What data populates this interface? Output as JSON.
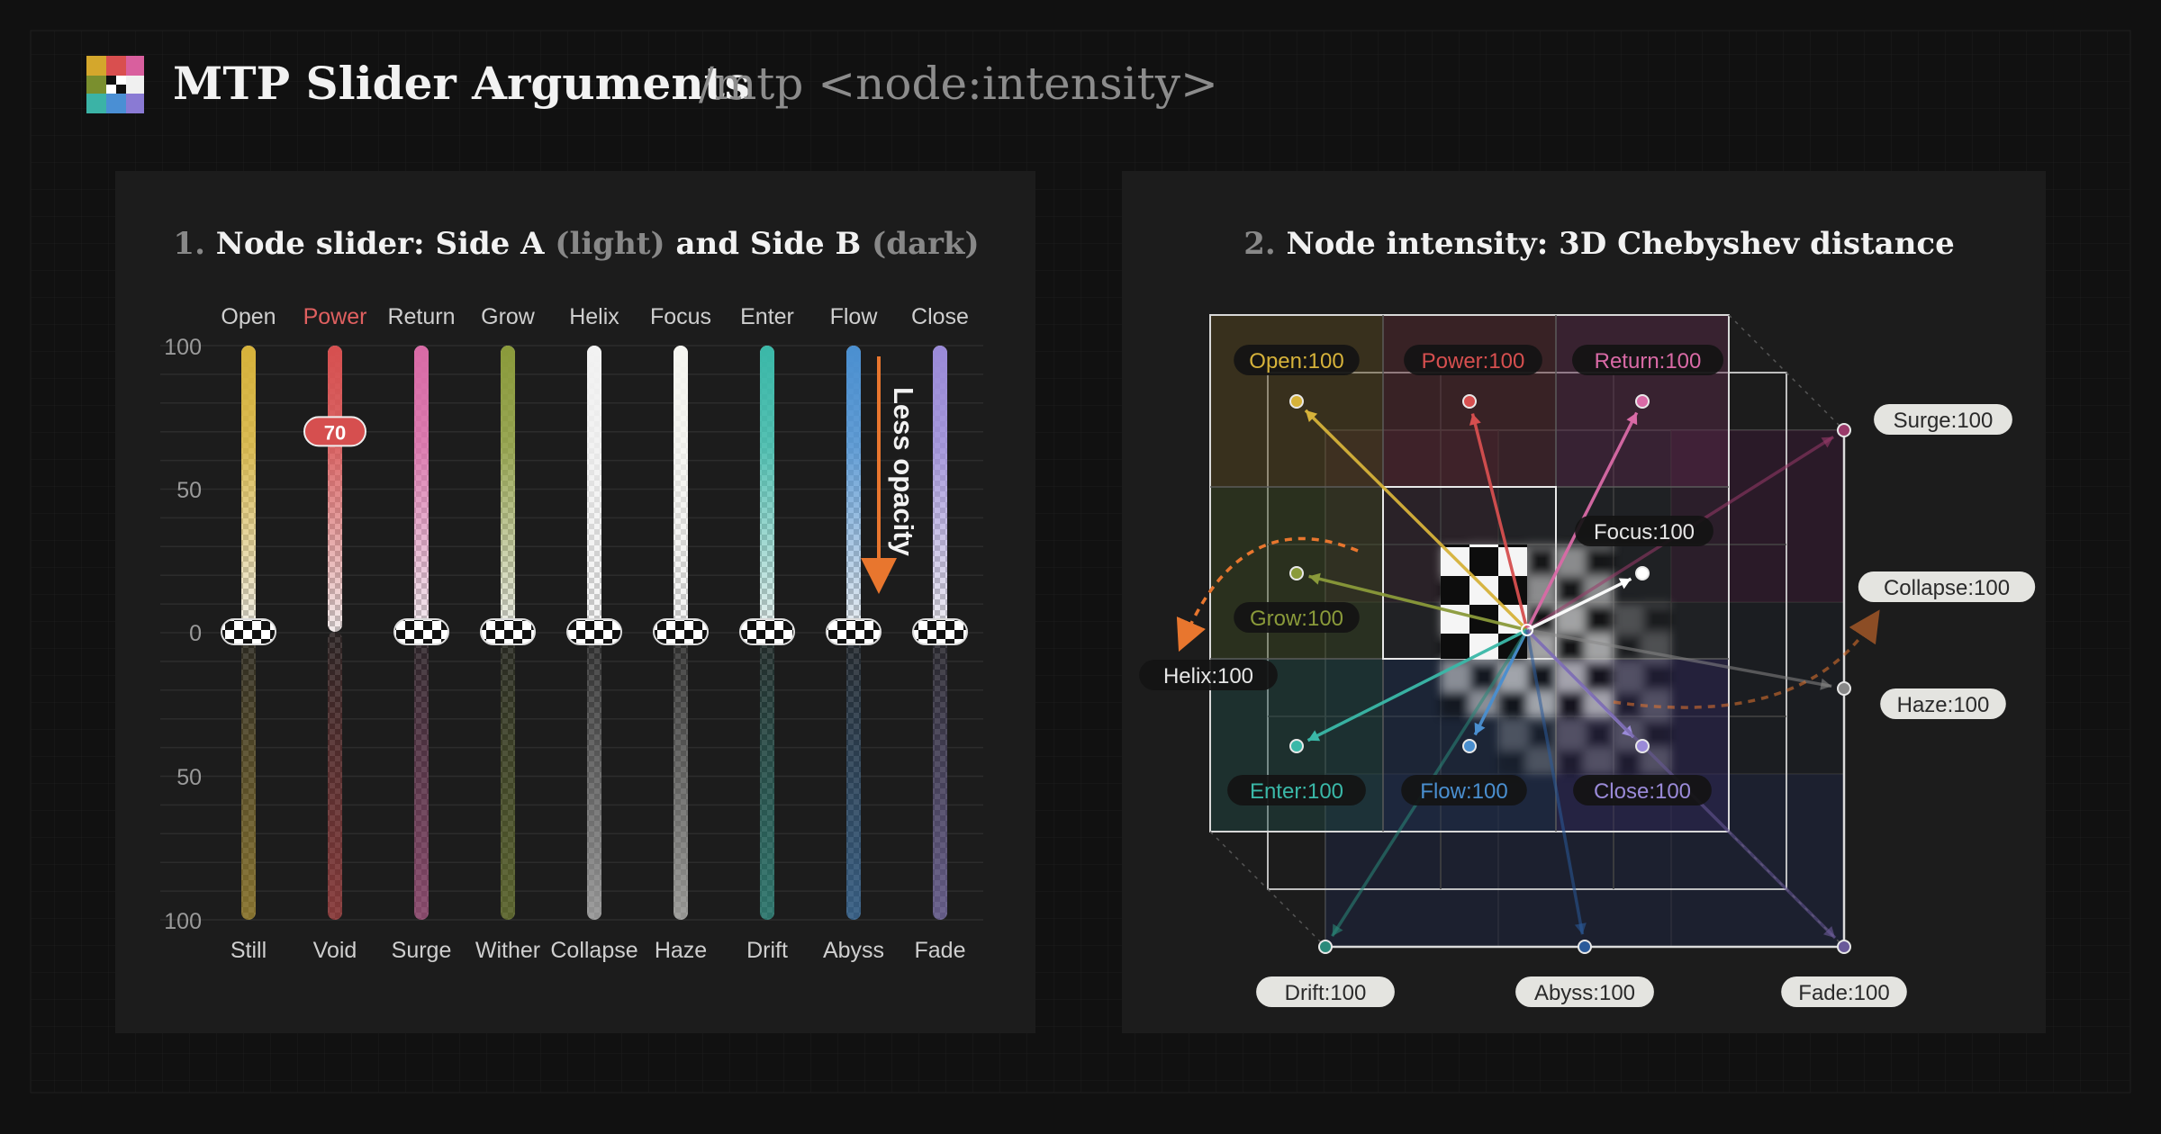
{
  "header": {
    "title": "MTP Slider Arguments",
    "command": "/mtp <node:intensity>",
    "logo_colors": [
      "#d4a72c",
      "#d94f4f",
      "#d95f9e",
      "#7a8f2e",
      "#3bb3a6",
      "#4a8fd4",
      "#8a7ad4"
    ]
  },
  "panel1": {
    "title_num": "1.",
    "title_a": "Node slider: Side A",
    "title_light": "(light)",
    "title_and": "and Side B",
    "title_dark": "(dark)",
    "y_ticks_top": [
      "100",
      "50",
      "0"
    ],
    "y_ticks_bottom": [
      "50",
      "100"
    ],
    "annotation": "Less opacity",
    "active_value": "70",
    "sliders": [
      {
        "top": "Open",
        "bottom": "Still",
        "color": "#d6b23a",
        "active": false
      },
      {
        "top": "Power",
        "bottom": "Void",
        "color": "#d64f4f",
        "active": true,
        "value": 70
      },
      {
        "top": "Return",
        "bottom": "Surge",
        "color": "#d96aa6",
        "active": false
      },
      {
        "top": "Grow",
        "bottom": "Wither",
        "color": "#8a9a3a",
        "active": false
      },
      {
        "top": "Helix",
        "bottom": "Collapse",
        "color": "#f2f2f2",
        "active": false
      },
      {
        "top": "Focus",
        "bottom": "Haze",
        "color": "#f5f5f0",
        "active": false
      },
      {
        "top": "Enter",
        "bottom": "Drift",
        "color": "#3ab8a8",
        "active": false
      },
      {
        "top": "Flow",
        "bottom": "Abyss",
        "color": "#4a8fd0",
        "active": false
      },
      {
        "top": "Close",
        "bottom": "Fade",
        "color": "#9a8ad8",
        "active": false
      }
    ],
    "colors": {
      "power_label": "#e06060",
      "annotation_arrow": "#e8762e"
    }
  },
  "panel2": {
    "title_num": "2.",
    "title_text": "Node intensity: 3D Chebyshev distance",
    "labels": {
      "open": "Open:100",
      "power": "Power:100",
      "return": "Return:100",
      "surge": "Surge:100",
      "focus": "Focus:100",
      "collapse": "Collapse:100",
      "grow": "Grow:100",
      "helix": "Helix:100",
      "haze": "Haze:100",
      "enter": "Enter:100",
      "flow": "Flow:100",
      "close": "Close:100",
      "drift": "Drift:100",
      "abyss": "Abyss:100",
      "fade": "Fade:100"
    }
  }
}
